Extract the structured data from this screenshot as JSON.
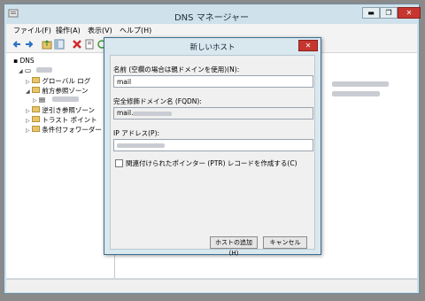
{
  "window": {
    "title": "DNS マネージャー",
    "min": "▬",
    "max": "❐",
    "close": "✕"
  },
  "menu": [
    "ファイル(F)",
    "操作(A)",
    "表示(V)",
    "ヘルプ(H)"
  ],
  "tree": {
    "root": "DNS",
    "server": "",
    "items": [
      "グローバル ログ",
      "前方参照ゾーン",
      "",
      "逆引き参照ゾーン",
      "トラスト ポイント",
      "条件付フォワーダー"
    ]
  },
  "dialog": {
    "title": "新しいホスト",
    "close": "✕",
    "name_label": "名前 (空欄の場合は親ドメインを使用)(N):",
    "name_value": "mail",
    "fqdn_label": "完全修飾ドメイン名 (FQDN):",
    "fqdn_value": "mail.",
    "ip_label": "IP アドレス(P):",
    "ip_value": "",
    "ptr_label": "関連付けられたポインター (PTR) レコードを作成する(C)",
    "ptr_checked": false,
    "add_button": "ホストの追加(H)",
    "cancel_button": "キャンセル"
  },
  "colors": {
    "accent": "#3f6f8f",
    "close": "#c6362f"
  }
}
